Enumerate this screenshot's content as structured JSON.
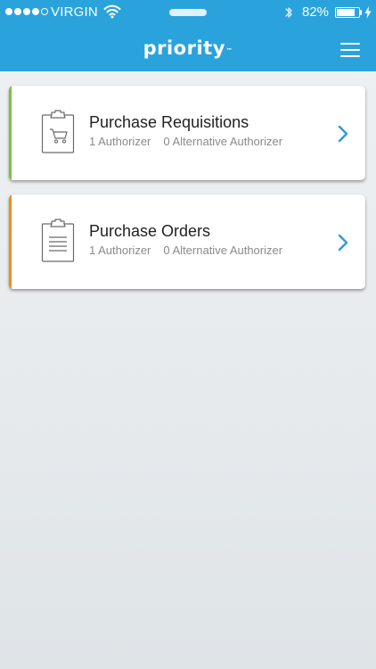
{
  "status_bar": {
    "carrier": "VIRGIN",
    "signal_strength": 4,
    "signal_max": 5,
    "battery_percent_label": "82%",
    "battery_level": 0.82
  },
  "header": {
    "logo": "priority",
    "logo_mark": "™",
    "menu_icon": "hamburger-menu-icon"
  },
  "colors": {
    "header_blue": "#2aa3dc",
    "requisitions_accent": "#7cc242",
    "orders_accent": "#f28c1e",
    "chevron_blue": "#2b9bd3"
  },
  "cards": [
    {
      "title": "Purchase Requisitions",
      "authorizer": "1 Authorizer",
      "alternative": "0 Alternative Authorizer",
      "icon": "clipboard-cart-icon"
    },
    {
      "title": "Purchase Orders",
      "authorizer": "1 Authorizer",
      "alternative": "0 Alternative Authorizer",
      "icon": "clipboard-list-icon"
    }
  ]
}
